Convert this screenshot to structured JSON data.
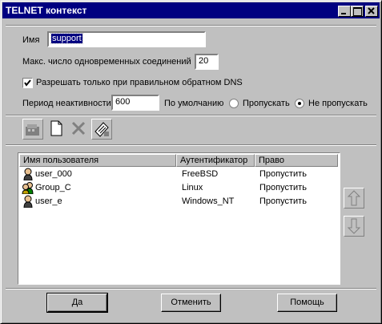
{
  "window": {
    "title": "TELNET контекст"
  },
  "form": {
    "name_label": "Имя",
    "name_value": "support",
    "max_conn_label": "Макс. число одновременных соединений",
    "max_conn_value": "20",
    "dns_check_label": "Разрешать только при правильном обратном DNS",
    "dns_checked": true,
    "idle_label": "Период неактивности",
    "idle_value": "600",
    "default_label": "По умолчанию",
    "radio_allow_label": "Пропускать",
    "radio_deny_label": "Не пропускать",
    "selected_radio": "deny"
  },
  "toolbar": {
    "buttons": [
      "properties-icon",
      "new-document-icon",
      "delete-icon",
      "key-pad-icon"
    ]
  },
  "table": {
    "columns": [
      "Имя пользователя",
      "Аутентификатор",
      "Право"
    ],
    "rows": [
      {
        "icon": "user-icon",
        "name": "user_000",
        "auth": "FreeBSD",
        "right": "Пропустить"
      },
      {
        "icon": "group-icon",
        "name": "Group_C",
        "auth": "Linux",
        "right": "Пропустить"
      },
      {
        "icon": "user-icon",
        "name": "user_e",
        "auth": "Windows_NT",
        "right": "Пропустить"
      }
    ]
  },
  "buttons": {
    "ok": "Да",
    "cancel": "Отменить",
    "help": "Помощь"
  },
  "colors": {
    "titlebar": "#000080",
    "face": "#c0c0c0",
    "selection": "#000080"
  }
}
